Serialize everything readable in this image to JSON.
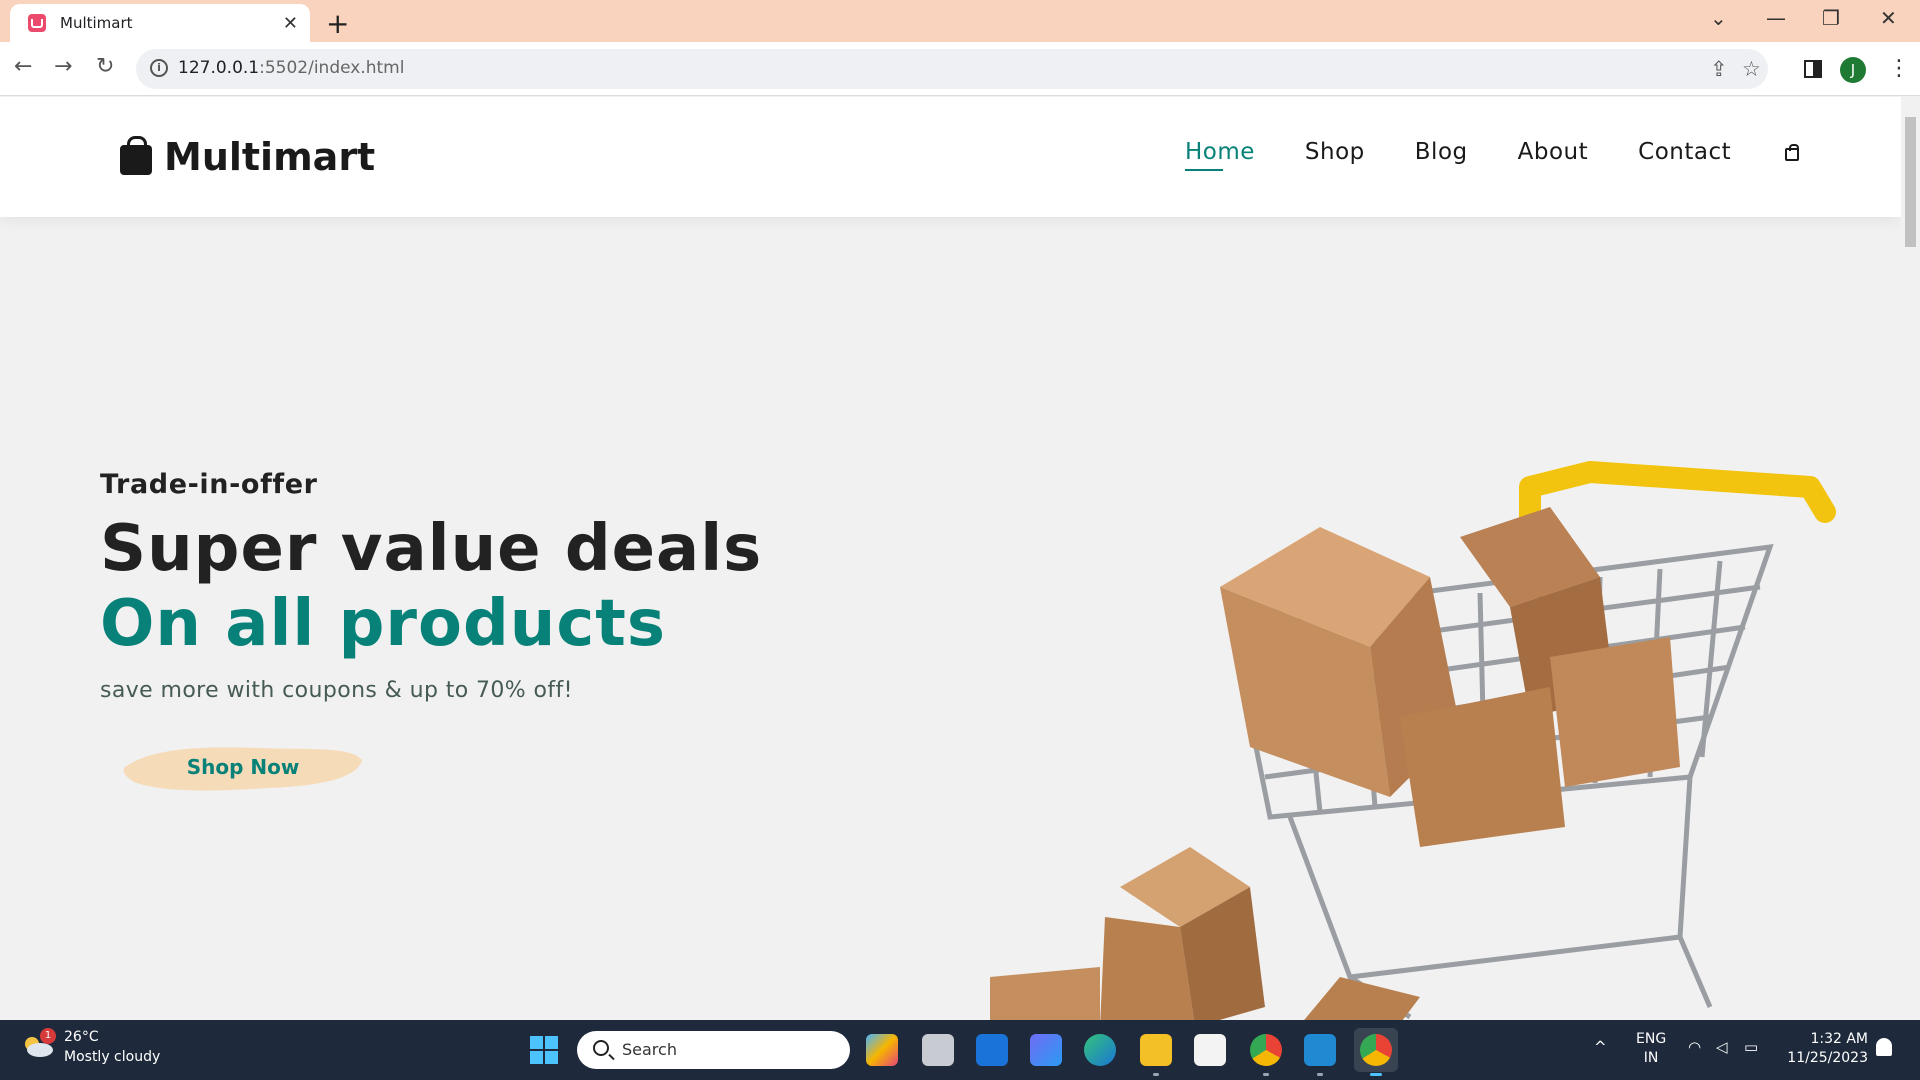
{
  "browser": {
    "tab_title": "Multimart",
    "tab_close": "✕",
    "new_tab": "+",
    "url_host": "127.0.0.1",
    "url_path": ":5502/index.html",
    "window_controls": {
      "collapse": "⌄",
      "minimize": "—",
      "restore": "❐",
      "close": "✕"
    },
    "profile_initial": "J"
  },
  "site": {
    "logo_text": "Multimart",
    "nav": [
      {
        "label": "Home",
        "active": true
      },
      {
        "label": "Shop"
      },
      {
        "label": "Blog"
      },
      {
        "label": "About"
      },
      {
        "label": "Contact"
      }
    ]
  },
  "hero": {
    "eyebrow": "Trade-in-offer",
    "headline": "Super value deals",
    "headline_accent": "On all products",
    "subtext": "save more with coupons & up to 70% off!",
    "button_label": "Shop Now"
  },
  "colors": {
    "accent": "#088178",
    "button_brush": "#f6dbb9",
    "tab_strip": "#f9d3bd",
    "taskbar": "#1e2a3b"
  },
  "taskbar": {
    "weather_badge": "1",
    "temperature": "26°C",
    "weather_desc": "Mostly cloudy",
    "search_placeholder": "Search",
    "lang_line1": "ENG",
    "lang_line2": "IN",
    "time": "1:32 AM",
    "date": "11/25/2023",
    "apps": [
      "copilot-pre-icon",
      "task-view-icon",
      "mail-icon",
      "bing-icon",
      "edge-icon",
      "file-explorer-icon",
      "store-icon",
      "chrome-icon",
      "vscode-icon",
      "chrome-profile-icon"
    ]
  }
}
